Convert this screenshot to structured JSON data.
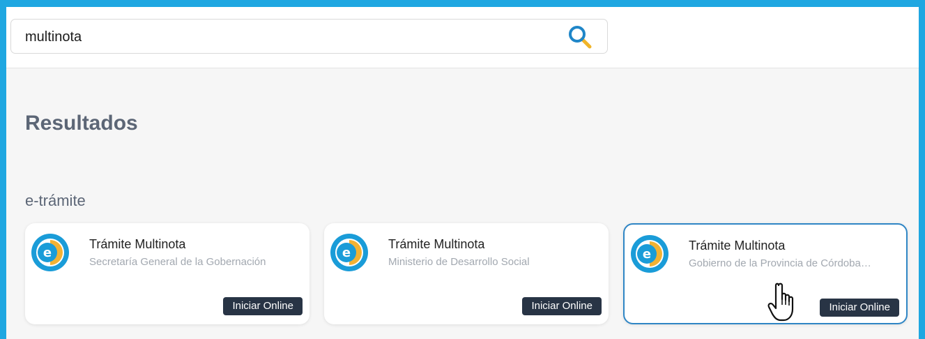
{
  "search": {
    "value": "multinota",
    "icon": "search-icon"
  },
  "results": {
    "heading": "Resultados",
    "section_title": "e-trámite",
    "cards": [
      {
        "title": "Trámite Multinota",
        "subtitle": "Secretaría General de la Gobernación",
        "button": "Iniciar Online",
        "icon": "e-tramite-logo-icon"
      },
      {
        "title": "Trámite Multinota",
        "subtitle": "Ministerio de Desarrollo Social",
        "button": "Iniciar Online",
        "icon": "e-tramite-logo-icon"
      },
      {
        "title": "Trámite Multinota",
        "subtitle": "Gobierno de la Provincia de Córdoba…",
        "button": "Iniciar Online",
        "icon": "e-tramite-logo-icon"
      }
    ]
  },
  "colors": {
    "frame": "#1fa7e1",
    "page_bg": "#f6f6f6",
    "button_bg": "#283445",
    "active_border": "#2f86c5",
    "heading": "#5c6676"
  }
}
